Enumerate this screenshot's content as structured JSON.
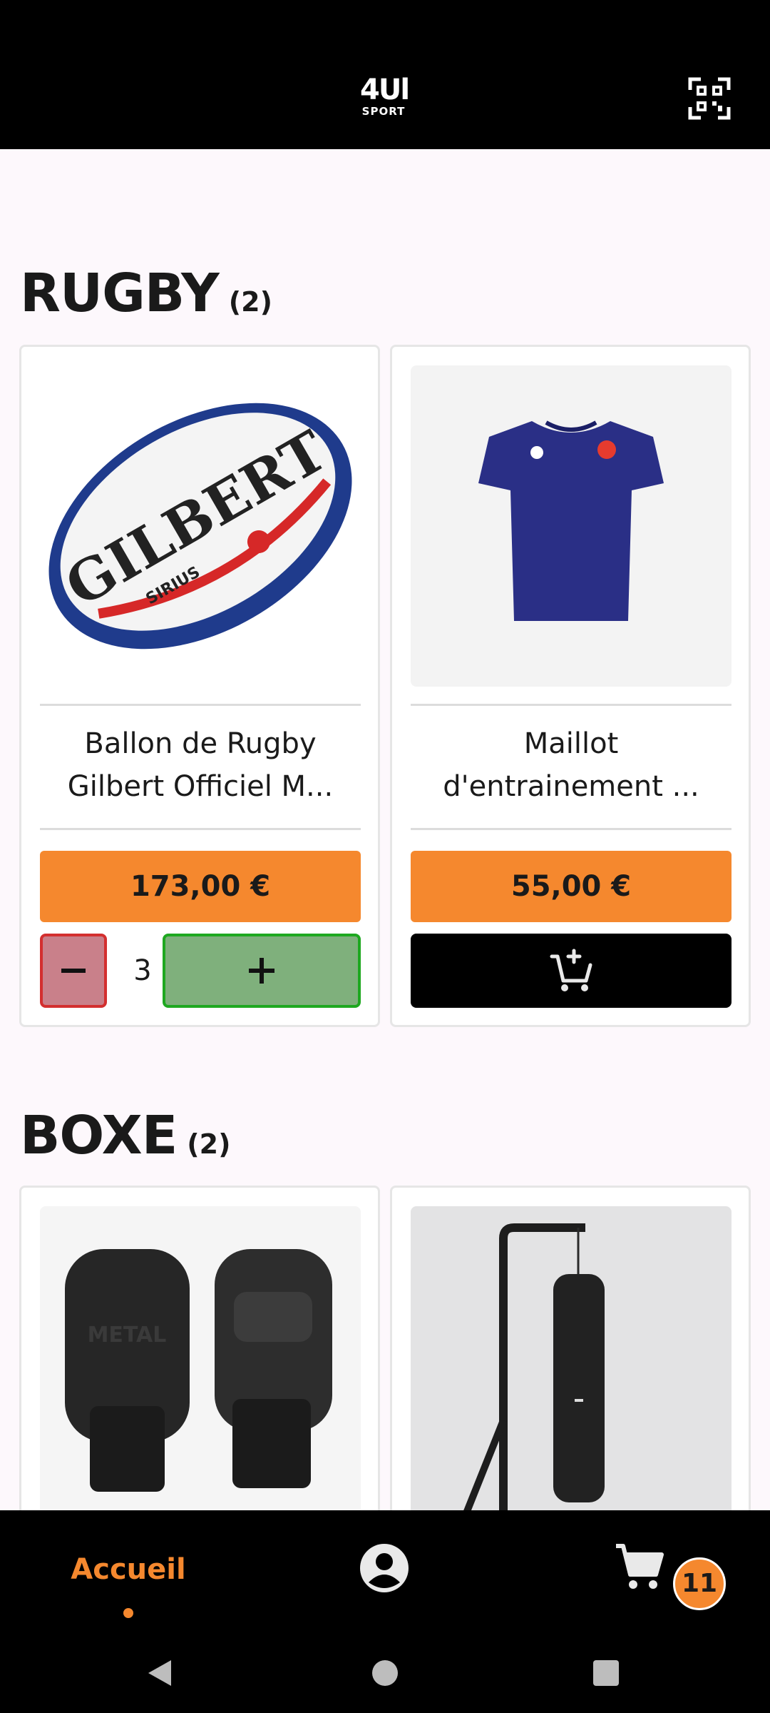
{
  "header": {
    "logo_top": "4Ul",
    "logo_bottom": "SPORT",
    "qr_icon": "qr-code-scan-icon"
  },
  "sections": [
    {
      "name": "RUGBY",
      "count": "(2)",
      "products": [
        {
          "title_line1": "Ballon de Rugby",
          "title_line2": "Gilbert Officiel M...",
          "price": "173,00 €",
          "quantity": "3",
          "image": "rugby-ball-image"
        },
        {
          "title_line1": "Maillot",
          "title_line2": "d'entrainement ...",
          "price": "55,00 €",
          "image": "navy-tshirt-image"
        }
      ]
    },
    {
      "name": "BOXE",
      "count": "(2)",
      "products": [
        {
          "image": "boxing-gloves-image"
        },
        {
          "image": "punching-bag-image"
        }
      ]
    }
  ],
  "bottom_nav": {
    "home_label": "Accueil",
    "cart_badge": "11"
  },
  "colors": {
    "accent": "#f5882e",
    "header_bg": "#000000",
    "minus_bg": "#c9808a",
    "minus_border": "#d32f2f",
    "plus_bg": "#7fb07c",
    "plus_border": "#1ea820"
  }
}
